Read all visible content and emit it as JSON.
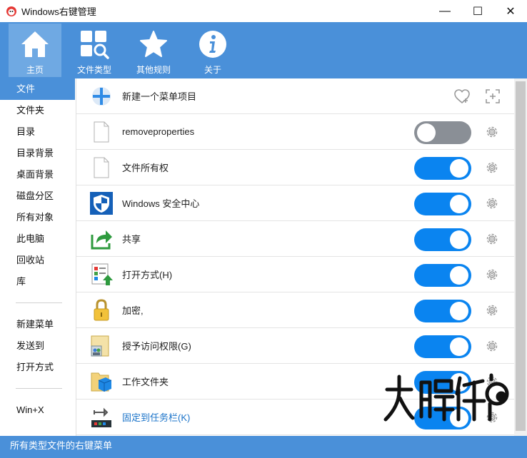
{
  "window": {
    "title": "Windows右键管理",
    "minimize": "—",
    "maximize": "☐",
    "close": "✕"
  },
  "toolbar": {
    "items": [
      {
        "label": "主页",
        "icon": "home-icon",
        "active": true
      },
      {
        "label": "文件类型",
        "icon": "file-types-icon",
        "active": false
      },
      {
        "label": "其他规则",
        "icon": "star-icon",
        "active": false
      },
      {
        "label": "关于",
        "icon": "info-icon",
        "active": false
      }
    ]
  },
  "sidebar": {
    "group1": [
      "文件",
      "文件夹",
      "目录",
      "目录背景",
      "桌面背景",
      "磁盘分区",
      "所有对象",
      "此电脑",
      "回收站",
      "库"
    ],
    "group2": [
      "新建菜单",
      "发送到",
      "打开方式"
    ],
    "group3": [
      "Win+X"
    ],
    "active": "文件"
  },
  "list": {
    "header": {
      "label": "新建一个菜单项目"
    },
    "rows": [
      {
        "label": "removeproperties",
        "enabled": false,
        "icon": "blank-file-icon"
      },
      {
        "label": "文件所有权",
        "enabled": true,
        "icon": "blank-file-icon"
      },
      {
        "label": "Windows 安全中心",
        "enabled": true,
        "icon": "shield-icon"
      },
      {
        "label": "共享",
        "enabled": true,
        "icon": "share-arrow-icon"
      },
      {
        "label": "打开方式(H)",
        "enabled": true,
        "icon": "open-with-icon"
      },
      {
        "label": "加密,",
        "enabled": true,
        "icon": "lock-icon"
      },
      {
        "label": "授予访问权限(G)",
        "enabled": true,
        "icon": "grant-access-icon"
      },
      {
        "label": "工作文件夹",
        "enabled": true,
        "icon": "work-folder-icon"
      },
      {
        "label": "固定到任务栏(K)",
        "enabled": true,
        "icon": "pin-taskbar-icon"
      }
    ]
  },
  "statusbar": {
    "text": "所有类型文件的右键菜单"
  },
  "watermark": {
    "text": "大眼仔~旭",
    "url": "dayanzai.me"
  },
  "colors": {
    "accent": "#4a90d9",
    "toggle_on": "#0a84f0",
    "toggle_off": "#8a8f96"
  }
}
